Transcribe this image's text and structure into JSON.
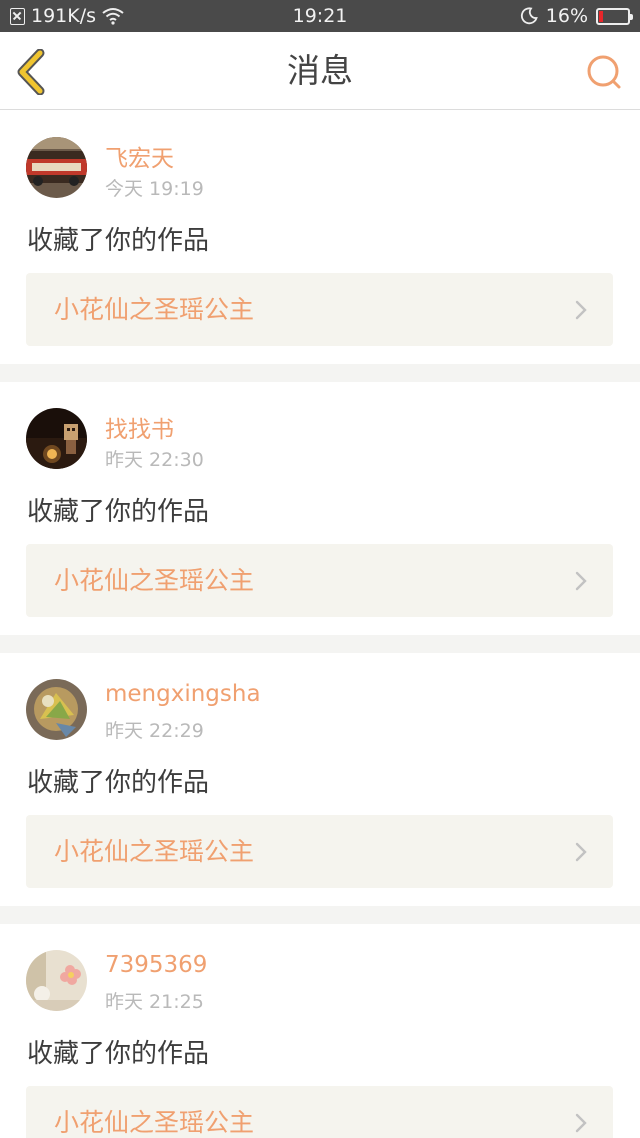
{
  "status_bar": {
    "speed": "191K/s",
    "time": "19:21",
    "battery": "16%",
    "battery_level": 0.16,
    "icons": [
      "sim-icon",
      "wifi-icon",
      "moon-icon",
      "battery-icon"
    ]
  },
  "header": {
    "title": "消息",
    "back_icon": "chevron-left-icon",
    "search_icon": "search-icon",
    "accent_color": "#f0a070",
    "back_color": "#f0c530"
  },
  "messages": [
    {
      "username": "飞宏天",
      "time": "今天 19:19",
      "action": "收藏了你的作品",
      "work_title": "小花仙之圣瑶公主"
    },
    {
      "username": "找找书",
      "time": "昨天 22:30",
      "action": "收藏了你的作品",
      "work_title": "小花仙之圣瑶公主"
    },
    {
      "username": "mengxingsha",
      "time": "昨天 22:29",
      "action": "收藏了你的作品",
      "work_title": "小花仙之圣瑶公主"
    },
    {
      "username": "7395369",
      "time": "昨天 21:25",
      "action": "收藏了你的作品",
      "work_title": "小花仙之圣瑶公主"
    }
  ]
}
